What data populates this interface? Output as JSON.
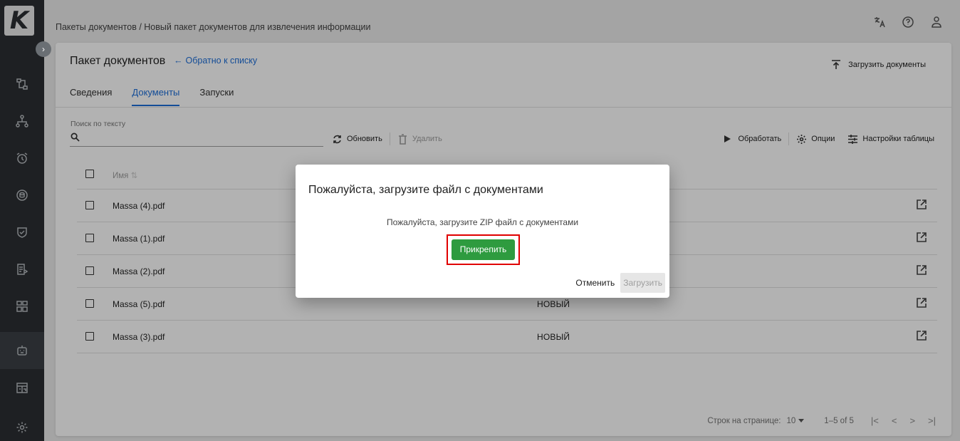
{
  "app": {
    "logo_letter": "K"
  },
  "breadcrumb": "Пакеты документов  /  Новый пакет документов для извлечения информации",
  "top_icons": [
    "translate-icon",
    "help-icon",
    "user-icon"
  ],
  "sidebar": {
    "items": [
      {
        "icon": "flow-icon"
      },
      {
        "icon": "hierarchy-icon"
      },
      {
        "icon": "alarm-icon"
      },
      {
        "icon": "database-icon"
      },
      {
        "icon": "shield-icon"
      },
      {
        "icon": "report-icon"
      },
      {
        "icon": "grid-icon"
      },
      {
        "icon": "robot-icon",
        "active": true
      },
      {
        "icon": "calendar-icon"
      },
      {
        "icon": "gear-icon"
      }
    ]
  },
  "header": {
    "title": "Пакет документов",
    "back_link": "Обратно к списку",
    "upload_button": "Загрузить документы"
  },
  "tabs": [
    {
      "label": "Сведения",
      "active": false
    },
    {
      "label": "Документы",
      "active": true
    },
    {
      "label": "Запуски",
      "active": false
    }
  ],
  "search": {
    "label": "Поиск по тексту",
    "value": ""
  },
  "toolbar": {
    "refresh": "Обновить",
    "delete": "Удалить",
    "process": "Обработать",
    "options": "Опции",
    "table_settings": "Настройки таблицы"
  },
  "table": {
    "name_header": "Имя",
    "rows": [
      {
        "name": "Massa (4).pdf",
        "status": ""
      },
      {
        "name": "Massa (1).pdf",
        "status": ""
      },
      {
        "name": "Massa (2).pdf",
        "status": ""
      },
      {
        "name": "Massa (5).pdf",
        "status": "НОВЫЙ"
      },
      {
        "name": "Massa (3).pdf",
        "status": "НОВЫЙ"
      }
    ]
  },
  "pagination": {
    "rows_per_page_label": "Строк на странице:",
    "rows_per_page": "10",
    "range": "1–5 of 5"
  },
  "dialog": {
    "title": "Пожалуйста, загрузите файл с документами",
    "text": "Пожалуйста, загрузите ZIP файл с документами",
    "attach_button": "Прикрепить",
    "cancel_button": "Отменить",
    "upload_button": "Загрузить"
  },
  "colors": {
    "accent": "#1e6fd9",
    "attach": "#2e9b3f",
    "highlight": "#e00000",
    "sidebar": "#2b2f33"
  }
}
